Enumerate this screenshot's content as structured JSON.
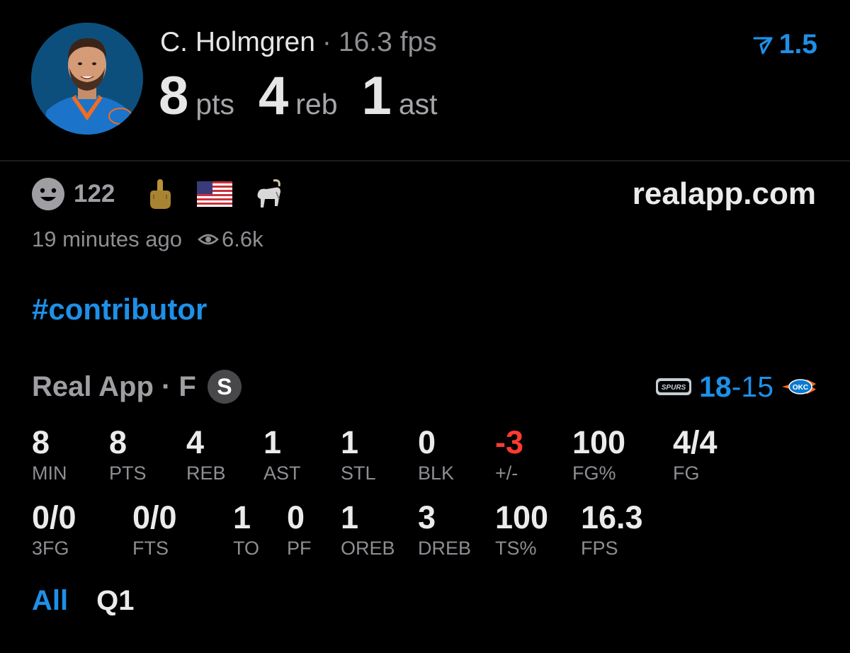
{
  "player": {
    "name": "C. Holmgren",
    "separator": "·",
    "fps": "16.3 fps",
    "stats": [
      {
        "value": "8",
        "unit": "pts"
      },
      {
        "value": "4",
        "unit": "reb"
      },
      {
        "value": "1",
        "unit": "ast"
      }
    ]
  },
  "line_badge": {
    "icon": "prediction-icon",
    "value": "1.5",
    "color": "#1e90e8"
  },
  "reactions": {
    "smile_icon": "smile-icon",
    "count": "122",
    "emojis": [
      "middle-finger-icon",
      "us-flag-icon",
      "goat-icon"
    ]
  },
  "source": "realapp.com",
  "meta": {
    "time": "19 minutes ago",
    "views": "6.6k"
  },
  "hashtag": "#contributor",
  "game": {
    "title": "Real App · F",
    "badge": "S",
    "home_team_logo": "spurs-logo",
    "away_team_logo": "okc-logo",
    "home_score": "18",
    "dash": "-",
    "away_score": "15"
  },
  "box_row1": [
    {
      "value": "8",
      "label": "MIN"
    },
    {
      "value": "8",
      "label": "PTS"
    },
    {
      "value": "4",
      "label": "REB"
    },
    {
      "value": "1",
      "label": "AST"
    },
    {
      "value": "1",
      "label": "STL"
    },
    {
      "value": "0",
      "label": "BLK"
    },
    {
      "value": "-3",
      "label": "+/-"
    },
    {
      "value": "100",
      "label": "FG%"
    },
    {
      "value": "4/4",
      "label": "FG"
    }
  ],
  "box_row2": [
    {
      "value": "0/0",
      "label": "3FG"
    },
    {
      "value": "0/0",
      "label": "FTS"
    },
    {
      "value": "1",
      "label": "TO"
    },
    {
      "value": "0",
      "label": "PF"
    },
    {
      "value": "1",
      "label": "OREB"
    },
    {
      "value": "3",
      "label": "DREB"
    },
    {
      "value": "100",
      "label": "TS%"
    },
    {
      "value": "16.3",
      "label": "FPS"
    }
  ],
  "tabs": [
    {
      "label": "All",
      "active": true
    },
    {
      "label": "Q1",
      "active": false
    }
  ],
  "colors": {
    "accent": "#1e90e8",
    "negative": "#ff3b30",
    "background": "#000000"
  }
}
